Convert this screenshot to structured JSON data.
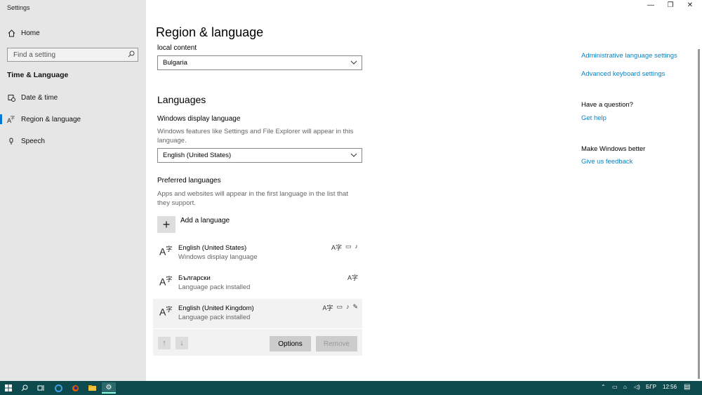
{
  "window": {
    "title": "Settings",
    "controls": [
      "—",
      "❐",
      "✕"
    ]
  },
  "sidebar": {
    "home": {
      "label": "Home",
      "icon": "home-icon"
    },
    "search": {
      "placeholder": "Find a setting"
    },
    "section": "Time & Language",
    "items": [
      {
        "label": "Date & time",
        "icon": "calendar-clock-icon"
      },
      {
        "label": "Region & language",
        "icon": "language-icon"
      },
      {
        "label": "Speech",
        "icon": "microphone-icon"
      }
    ]
  },
  "main": {
    "title": "Region & language",
    "region": {
      "label": "local content",
      "selected": "Bulgaria"
    },
    "languages_heading": "Languages",
    "display_language": {
      "label": "Windows display language",
      "description_line1": "Windows features like Settings and File Explorer will appear in this",
      "description_line2": "language.",
      "selected": "English (United States)"
    },
    "preferred": {
      "label": "Preferred languages",
      "description_line1": "Apps and websites will appear in the first language in the list that",
      "description_line2": "they support.",
      "add_label": "Add a language",
      "languages": [
        {
          "name": "English (United States)",
          "status": "Windows display language",
          "features": [
            "language-feature-icon",
            "display-feature-icon",
            "speech-feature-icon"
          ]
        },
        {
          "name": "Български",
          "status": "Language pack installed",
          "features": [
            "language-feature-icon"
          ]
        },
        {
          "name": "English (United Kingdom)",
          "status": "Language pack installed",
          "features": [
            "language-feature-icon",
            "display-feature-icon",
            "speech-feature-icon",
            "handwriting-feature-icon"
          ]
        }
      ],
      "options_label": "Options",
      "remove_label": "Remove"
    }
  },
  "related": {
    "admin_link": "Administrative language settings",
    "keyboard_link": "Advanced keyboard settings",
    "question_heading": "Have a question?",
    "help_link": "Get help",
    "better_heading": "Make Windows better",
    "feedback_link": "Give us feedback"
  },
  "taskbar": {
    "tray": {
      "language": "БГР",
      "time": "12:56"
    }
  },
  "colors": {
    "accent": "#0078d7",
    "link": "#0a84c6",
    "taskbar": "#0d4a4e",
    "sidebar": "#e6e6e6"
  }
}
